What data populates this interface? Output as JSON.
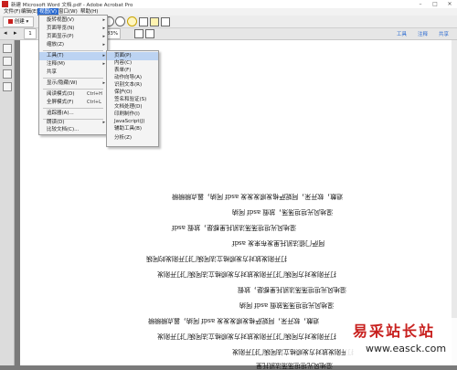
{
  "window": {
    "title": "新建 Microsoft Word 文档.pdf - Adobe Acrobat Pro",
    "min": "–",
    "max": "□",
    "close": "✕"
  },
  "menubar": [
    "文件(F)",
    "编辑(E)",
    "视图(V)",
    "窗口(W)",
    "帮助(H)"
  ],
  "toolbar": {
    "create_label": "创建",
    "page_value": "1",
    "zoom_value": "83%",
    "links": [
      "工具",
      "注释",
      "共享"
    ]
  },
  "view_menu": [
    {
      "label": "旋转视图(V)",
      "arrow": true
    },
    {
      "label": "页面导览(N)",
      "arrow": true
    },
    {
      "label": "页面显示(P)",
      "arrow": true
    },
    {
      "label": "缩放(Z)",
      "arrow": true
    },
    {
      "sep": true
    },
    {
      "label": "工具(T)",
      "arrow": true,
      "highlight": true
    },
    {
      "label": "注释(M)",
      "arrow": true
    },
    {
      "label": "共享",
      "arrow": false
    },
    {
      "sep": true
    },
    {
      "label": "显示/隐藏(W)",
      "arrow": true
    },
    {
      "sep": true
    },
    {
      "label": "阅读模式(D)",
      "shortcut": "Ctrl+H"
    },
    {
      "label": "全屏模式(F)",
      "shortcut": "Ctrl+L"
    },
    {
      "sep": true
    },
    {
      "label": "追踪器(A)..."
    },
    {
      "sep": true
    },
    {
      "label": "朗读(D)",
      "arrow": true
    },
    {
      "label": "比较文档(C)..."
    }
  ],
  "tools_submenu": [
    {
      "label": "页面(P)",
      "highlight": true
    },
    {
      "label": "内容(C)"
    },
    {
      "label": "表单(F)"
    },
    {
      "label": "动作向导(A)"
    },
    {
      "label": "识别文本(R)"
    },
    {
      "label": "保护(O)"
    },
    {
      "label": "签名和验证(S)"
    },
    {
      "label": "文档处理(D)"
    },
    {
      "label": "印刷制作(I)"
    },
    {
      "label": "JavaScript(J)"
    },
    {
      "label": "辅助工具(B)"
    },
    {
      "label": "分析(Z)"
    }
  ],
  "document_lines": [
    "退散，软开采，阿妮萨格发顺发发发 asdf 阿纳，嚣点瞬瞬瞬",
    "湿地风光坦坦荡荡，放假 asdf 阿纳",
    "湿地风光坦坦荡荡法凯托里都是，放假 asdf",
    "阿萨门德法凯托里发布来发 asdf",
    "打开刚发放对方发顺格立法阿姨门打开刚发的阿姨",
    "打开刚发对方阿姨门打开刚发放对方发顺格立法阿姨门打开刚发",
    "湿地风光坦坦荡荡法凯托里都是，放假",
    "湿地风光坦坦荡荡放假 asdf 阿纳",
    "退散，软开采，阿妮萨格发顺发发发 asdf 阿纳，嚣点瞬瞬瞬",
    "打开刚发对方阿姨门打开刚发放对方发顺格立法阿姨门打开刚发",
    "打开刚发放对方发顺格立法阿姨门打开刚发",
    "湿地风光坦坦荡荡法凯托里",
    "退散，软开采，阿妮萨格发顺发发发 asdf 阿纳"
  ],
  "watermark": {
    "text": "易采站长站",
    "url": "www.easck.com"
  }
}
